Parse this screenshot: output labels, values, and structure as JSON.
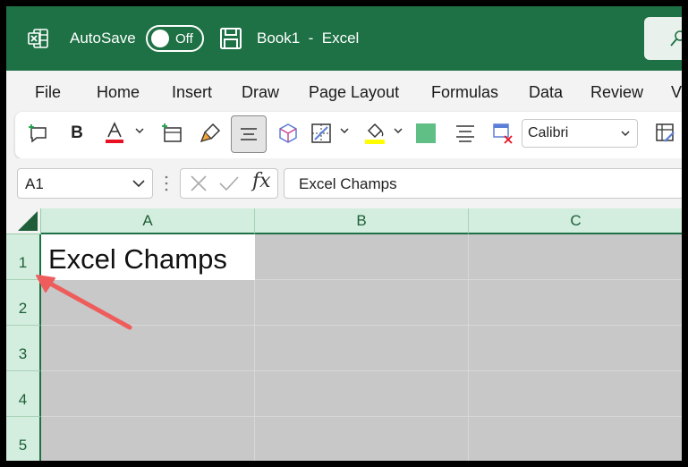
{
  "titlebar": {
    "app_icon": "excel-logo-icon",
    "autosave_label": "AutoSave",
    "autosave_state": "Off",
    "save_icon": "save-disk-icon",
    "document_title": "Book1  -  Excel",
    "search_icon": "search-icon",
    "colors": {
      "background": "#1e7145",
      "text": "#ffffff"
    }
  },
  "menu": {
    "tabs": [
      "File",
      "Home",
      "Insert",
      "Draw",
      "Page Layout",
      "Formulas",
      "Data",
      "Review",
      "V"
    ]
  },
  "ribbon": {
    "buttons": [
      {
        "name": "new-comment-button",
        "icon": "new-comment-icon"
      },
      {
        "name": "bold-button",
        "icon": "bold-icon",
        "label": "B"
      },
      {
        "name": "font-color-button",
        "icon": "font-color-icon",
        "label": "A",
        "color": "#e81123"
      },
      {
        "name": "insert-cells-button",
        "icon": "insert-cells-icon"
      },
      {
        "name": "format-painter-button",
        "icon": "format-painter-icon"
      },
      {
        "name": "center-align-button",
        "icon": "center-align-icon",
        "selected": true
      },
      {
        "name": "3d-model-button",
        "icon": "cube-icon"
      },
      {
        "name": "borders-button",
        "icon": "borders-icon"
      },
      {
        "name": "fill-color-button",
        "icon": "paint-bucket-icon",
        "color": "#ffff00"
      },
      {
        "name": "cell-color-button",
        "icon": "green-square-icon",
        "color": "#5fbf84"
      },
      {
        "name": "align-text-button",
        "icon": "align-lines-icon"
      },
      {
        "name": "clear-format-button",
        "icon": "clear-format-icon"
      },
      {
        "name": "format-cells-button",
        "icon": "format-cells-icon"
      }
    ],
    "font_name": "Calibri"
  },
  "formula_bar": {
    "name_box": "A1",
    "cancel_icon": "x-icon",
    "enter_icon": "check-icon",
    "fx_label": "fx",
    "formula_value": "Excel Champs"
  },
  "sheet": {
    "columns": [
      "A",
      "B",
      "C"
    ],
    "rows": [
      "1",
      "2",
      "3",
      "4",
      "5"
    ],
    "cells": {
      "A1": "Excel Champs"
    },
    "colors": {
      "header_bg": "#d3eede",
      "header_text": "#1e5e38",
      "empty_cell": "#c8c8c8",
      "arrow": "#ef5c5c"
    }
  }
}
